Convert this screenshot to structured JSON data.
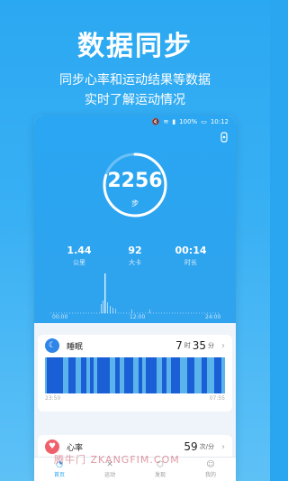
{
  "hero": {
    "title": "数据同步",
    "line1": "同步心率和运动结果等数据",
    "line2": "实时了解运动情况"
  },
  "status_bar": {
    "battery": "100%",
    "time": "10:12"
  },
  "activity": {
    "steps": "2256",
    "steps_unit": "步",
    "progress_fraction": 0.8,
    "stats": [
      {
        "value": "1.44",
        "unit": "公里"
      },
      {
        "value": "92",
        "unit": "大卡"
      },
      {
        "value": "00:14",
        "unit": "时长"
      }
    ],
    "timeline": [
      "00:00",
      "12:00",
      "24:00"
    ]
  },
  "sleep": {
    "label": "睡眠",
    "hours": "7",
    "hours_unit": "时",
    "minutes": "35",
    "minutes_unit": "分",
    "start": "23:50",
    "end": "07:55"
  },
  "heart": {
    "label": "心率",
    "value": "59",
    "unit": "次/分"
  },
  "tabs": [
    {
      "label": "首页",
      "icon": "home-icon"
    },
    {
      "label": "运动",
      "icon": "run-icon"
    },
    {
      "label": "发现",
      "icon": "cube-icon"
    },
    {
      "label": "我的",
      "icon": "user-icon"
    }
  ],
  "watermark": "腾牛门 ZKANGFIM.COM",
  "colors": {
    "accent": "#2aa5ef",
    "deep_sleep": "#1a5fd6",
    "light_sleep": "#5bb3ec",
    "heart": "#f0606b",
    "sleep_icon": "#2f86e8"
  }
}
